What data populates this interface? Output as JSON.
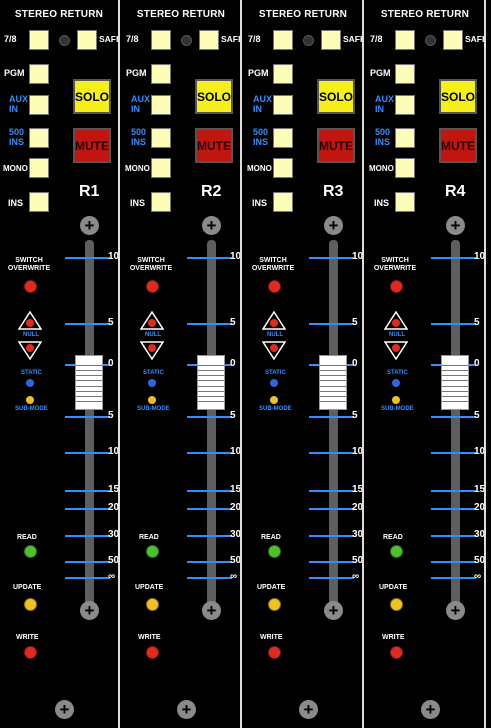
{
  "colors": {
    "panel": "#000000",
    "button_pale_yellow": "#fefdb8",
    "solo_yellow": "#f6ef1a",
    "mute_red": "#c11510",
    "led_red": "#e02a1c",
    "led_green": "#4cc02f",
    "led_yellow": "#f2c022",
    "tick_blue": "#2e8fff",
    "label_blue": "#2e8fff"
  },
  "labels": {
    "header": "STEREO RETURN",
    "btn_78": "7/8",
    "btn_safe": "SAFE",
    "btn_pgm": "PGM",
    "btn_aux": "AUX\nIN",
    "btn_500": "500\nINS",
    "btn_mono": "MONO",
    "btn_ins": "INS",
    "solo": "SOLO",
    "mute": "MUTE",
    "switch_overwrite": "SWITCH\nOVERWRITE",
    "null": "NULL",
    "static": "STATIC",
    "submode": "SUB-MODE",
    "read": "READ",
    "update": "UPDATE",
    "write": "WRITE",
    "plus": "+"
  },
  "fader_scale": [
    "10",
    "5",
    "0",
    "5",
    "10",
    "15",
    "20",
    "30",
    "50",
    "∞"
  ],
  "strips": [
    {
      "name": "R1"
    },
    {
      "name": "R2"
    },
    {
      "name": "R3"
    },
    {
      "name": "R4"
    }
  ]
}
